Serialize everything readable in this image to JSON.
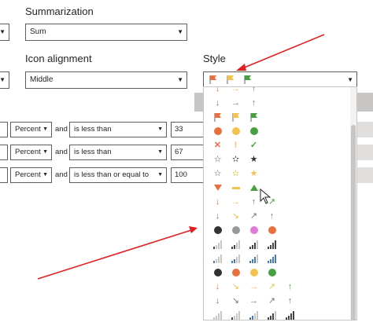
{
  "headings": {
    "summarization": "Summarization",
    "icon_alignment": "Icon alignment",
    "style": "Style"
  },
  "summarization_value": "Sum",
  "icon_alignment_value": "Middle",
  "rules": [
    {
      "unit": "Percent",
      "and": "and",
      "operator": "is less than",
      "value": "33"
    },
    {
      "unit": "Percent",
      "and": "and",
      "operator": "is less than",
      "value": "67"
    },
    {
      "unit": "Percent",
      "and": "and",
      "operator": "is less than or equal to",
      "value": "100"
    }
  ],
  "style_dropdown": {
    "icon_set_names": [
      "flags-set",
      "arrows-gray-set",
      "flags-set-2",
      "circles-set",
      "symbols-set",
      "stars-outline-set",
      "stars-half-set",
      "triangles-set",
      "arrows-colored-set",
      "arrows-gray-diagonal-set",
      "circles-dark-set",
      "bars-set",
      "bars-blue-set",
      "circles-set-2",
      "arrows-5-set",
      "bars-5-set",
      "bars-5-gray-set"
    ]
  },
  "colors": {
    "red": "#e9703c",
    "yellow": "#f2c14e",
    "green": "#47a041",
    "annotation_arrow": "#e02020"
  }
}
